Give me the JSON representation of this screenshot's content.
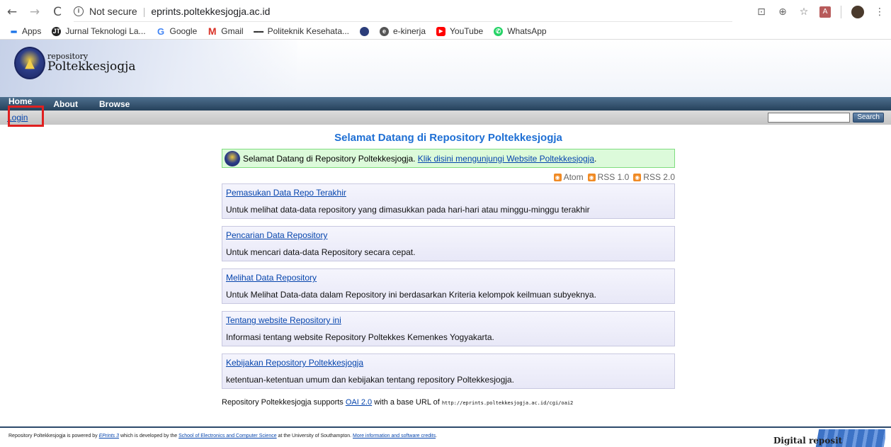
{
  "browser": {
    "url_security": "Not secure",
    "url": "eprints.poltekkesjogja.ac.id",
    "bookmarks": [
      {
        "label": "Apps",
        "icon": "apps-grid-icon"
      },
      {
        "label": "Jurnal Teknologi La...",
        "icon": "jurnal-icon"
      },
      {
        "label": "Google",
        "icon": "google-icon"
      },
      {
        "label": "Gmail",
        "icon": "gmail-icon"
      },
      {
        "label": "Politeknik Kesehata...",
        "icon": "poltekkes-icon"
      },
      {
        "label": "",
        "icon": "university-logo-icon"
      },
      {
        "label": "e-kinerja",
        "icon": "ekinerja-icon"
      },
      {
        "label": "YouTube",
        "icon": "youtube-icon"
      },
      {
        "label": "WhatsApp",
        "icon": "whatsapp-icon"
      }
    ]
  },
  "site": {
    "logo_small": "repository",
    "logo_big": "Poltekkesjogja",
    "nav": {
      "home": "Home",
      "about": "About",
      "browse": "Browse"
    },
    "login": "Login",
    "search_button": "Search"
  },
  "main": {
    "title": "Selamat Datang di Repository Poltekkesjogja",
    "welcome_text": "Selamat Datang di Repository Poltekkesjogja. ",
    "welcome_link": "Klik disini mengunjungi Website Poltekkesjogja",
    "welcome_end": ".",
    "feeds": [
      "Atom",
      "RSS 1.0",
      "RSS 2.0"
    ],
    "boxes": [
      {
        "link": "Pemasukan Data Repo Terakhir",
        "desc": "Untuk melihat data-data repository yang dimasukkan pada hari-hari atau minggu-minggu terakhir"
      },
      {
        "link": "Pencarian Data Repository",
        "desc": "Untuk mencari data-data Repository secara cepat."
      },
      {
        "link": "Melihat Data Repository",
        "desc": "Untuk Melihat Data-data dalam Repository ini berdasarkan Kriteria kelompok keilmuan subyeknya."
      },
      {
        "link": "Tentang website Repository ini",
        "desc": "Informasi tentang website Repository Poltekkes Kemenkes Yogyakarta."
      },
      {
        "link": "Kebijakan Repository Poltekkesjogja",
        "desc": "ketentuan-ketentuan umum dan kebijakan tentang repository Poltekkesjogja."
      }
    ],
    "oai_pre": "Repository Poltekkesjogja supports ",
    "oai_link": "OAI 2.0",
    "oai_mid": " with a base URL of ",
    "oai_url": "http://eprints.poltekkesjogja.ac.id/cgi/oai2"
  },
  "footer": {
    "t1": "Repository Poltekkesjogja is powered by ",
    "l1": "EPrints 3",
    "t2": " which is developed by the ",
    "l2": "School of Electronics and Computer Science",
    "t3": " at the University of Southampton. ",
    "l3": "More information and software credits",
    "t4": ".",
    "badge": "Digital reposit"
  }
}
